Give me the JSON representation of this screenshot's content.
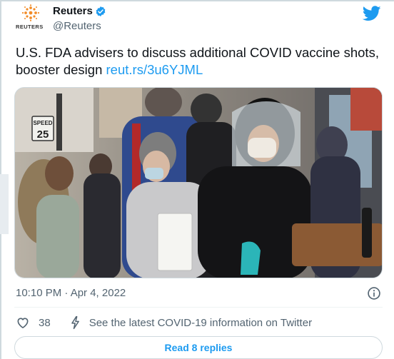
{
  "author": {
    "name": "Reuters",
    "handle": "@Reuters",
    "logo_text": "REUTERS",
    "avatar_icon": "reuters-logo",
    "verified_icon": "verified-badge-icon"
  },
  "brand_icon": "twitter-bird-icon",
  "tweet": {
    "text": "U.S. FDA advisers to discuss additional COVID vaccine shots, booster design ",
    "link": "reut.rs/3u6YJML"
  },
  "media": {
    "icon": "news-photo-crowd-masks"
  },
  "meta": {
    "timestamp": "10:10 PM · Apr 4, 2022",
    "info_icon": "info-icon"
  },
  "actions": {
    "like_icon": "heart-icon",
    "like_count": "38",
    "info_banner_icon": "lightning-icon",
    "covid_info": "See the latest COVID-19 information on Twitter"
  },
  "replies": {
    "label": "Read 8 replies"
  },
  "colors": {
    "accent": "#1d9bf0",
    "text": "#0f1419",
    "muted": "#536471",
    "border": "#cfd9de"
  }
}
